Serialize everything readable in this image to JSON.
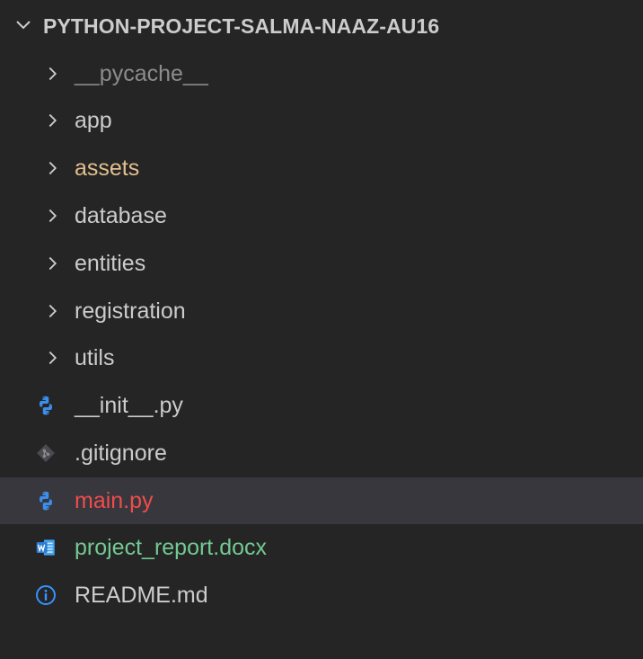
{
  "explorer": {
    "root": {
      "label": "PYTHON-PROJECT-SALMA-NAAZ-AU16",
      "icon": "chevron-down-icon",
      "expanded": true
    },
    "folders": [
      {
        "label": "__pycache__",
        "icon": "chevron-right-icon",
        "color": "#8c8c8c"
      },
      {
        "label": "app",
        "icon": "chevron-right-icon",
        "color": "#cccccc"
      },
      {
        "label": "assets",
        "icon": "chevron-right-icon",
        "color": "#e2c08d"
      },
      {
        "label": "database",
        "icon": "chevron-right-icon",
        "color": "#cccccc"
      },
      {
        "label": "entities",
        "icon": "chevron-right-icon",
        "color": "#cccccc"
      },
      {
        "label": "registration",
        "icon": "chevron-right-icon",
        "color": "#cccccc"
      },
      {
        "label": "utils",
        "icon": "chevron-right-icon",
        "color": "#cccccc"
      }
    ],
    "files": [
      {
        "label": "__init__.py",
        "icon": "python-icon",
        "color": "#cccccc"
      },
      {
        "label": ".gitignore",
        "icon": "git-icon",
        "color": "#cccccc"
      },
      {
        "label": "main.py",
        "icon": "python-icon",
        "color": "#f14c4c",
        "selected": true
      },
      {
        "label": "project_report.docx",
        "icon": "word-icon",
        "color": "#73c991"
      },
      {
        "label": "README.md",
        "icon": "info-icon",
        "color": "#cccccc"
      }
    ]
  },
  "colors": {
    "background": "#252526",
    "selected_row": "#37373d",
    "python_blue": "#3b8eea",
    "word_blue": "#2b7cd3",
    "info_blue": "#3794ff"
  }
}
